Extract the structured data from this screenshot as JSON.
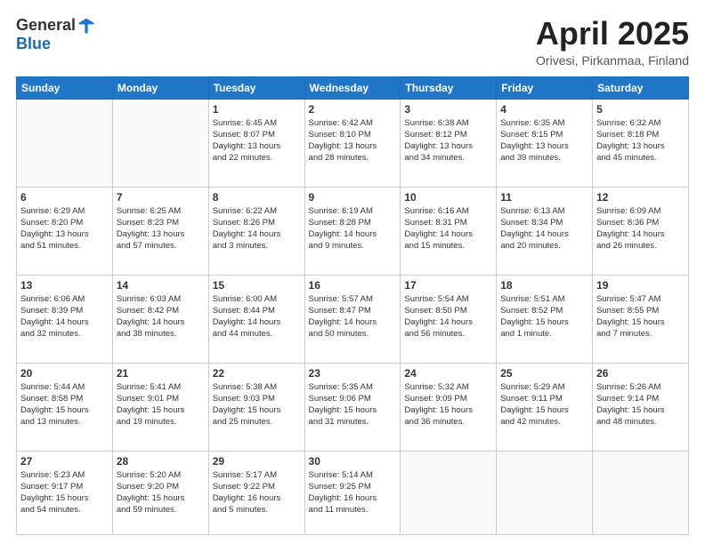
{
  "logo": {
    "general": "General",
    "blue": "Blue"
  },
  "title": "April 2025",
  "subtitle": "Orivesi, Pirkanmaa, Finland",
  "days_header": [
    "Sunday",
    "Monday",
    "Tuesday",
    "Wednesday",
    "Thursday",
    "Friday",
    "Saturday"
  ],
  "weeks": [
    [
      {
        "day": "",
        "info": ""
      },
      {
        "day": "",
        "info": ""
      },
      {
        "day": "1",
        "info": "Sunrise: 6:45 AM\nSunset: 8:07 PM\nDaylight: 13 hours\nand 22 minutes."
      },
      {
        "day": "2",
        "info": "Sunrise: 6:42 AM\nSunset: 8:10 PM\nDaylight: 13 hours\nand 28 minutes."
      },
      {
        "day": "3",
        "info": "Sunrise: 6:38 AM\nSunset: 8:12 PM\nDaylight: 13 hours\nand 34 minutes."
      },
      {
        "day": "4",
        "info": "Sunrise: 6:35 AM\nSunset: 8:15 PM\nDaylight: 13 hours\nand 39 minutes."
      },
      {
        "day": "5",
        "info": "Sunrise: 6:32 AM\nSunset: 8:18 PM\nDaylight: 13 hours\nand 45 minutes."
      }
    ],
    [
      {
        "day": "6",
        "info": "Sunrise: 6:29 AM\nSunset: 8:20 PM\nDaylight: 13 hours\nand 51 minutes."
      },
      {
        "day": "7",
        "info": "Sunrise: 6:25 AM\nSunset: 8:23 PM\nDaylight: 13 hours\nand 57 minutes."
      },
      {
        "day": "8",
        "info": "Sunrise: 6:22 AM\nSunset: 8:26 PM\nDaylight: 14 hours\nand 3 minutes."
      },
      {
        "day": "9",
        "info": "Sunrise: 6:19 AM\nSunset: 8:28 PM\nDaylight: 14 hours\nand 9 minutes."
      },
      {
        "day": "10",
        "info": "Sunrise: 6:16 AM\nSunset: 8:31 PM\nDaylight: 14 hours\nand 15 minutes."
      },
      {
        "day": "11",
        "info": "Sunrise: 6:13 AM\nSunset: 8:34 PM\nDaylight: 14 hours\nand 20 minutes."
      },
      {
        "day": "12",
        "info": "Sunrise: 6:09 AM\nSunset: 8:36 PM\nDaylight: 14 hours\nand 26 minutes."
      }
    ],
    [
      {
        "day": "13",
        "info": "Sunrise: 6:06 AM\nSunset: 8:39 PM\nDaylight: 14 hours\nand 32 minutes."
      },
      {
        "day": "14",
        "info": "Sunrise: 6:03 AM\nSunset: 8:42 PM\nDaylight: 14 hours\nand 38 minutes."
      },
      {
        "day": "15",
        "info": "Sunrise: 6:00 AM\nSunset: 8:44 PM\nDaylight: 14 hours\nand 44 minutes."
      },
      {
        "day": "16",
        "info": "Sunrise: 5:57 AM\nSunset: 8:47 PM\nDaylight: 14 hours\nand 50 minutes."
      },
      {
        "day": "17",
        "info": "Sunrise: 5:54 AM\nSunset: 8:50 PM\nDaylight: 14 hours\nand 56 minutes."
      },
      {
        "day": "18",
        "info": "Sunrise: 5:51 AM\nSunset: 8:52 PM\nDaylight: 15 hours\nand 1 minute."
      },
      {
        "day": "19",
        "info": "Sunrise: 5:47 AM\nSunset: 8:55 PM\nDaylight: 15 hours\nand 7 minutes."
      }
    ],
    [
      {
        "day": "20",
        "info": "Sunrise: 5:44 AM\nSunset: 8:58 PM\nDaylight: 15 hours\nand 13 minutes."
      },
      {
        "day": "21",
        "info": "Sunrise: 5:41 AM\nSunset: 9:01 PM\nDaylight: 15 hours\nand 19 minutes."
      },
      {
        "day": "22",
        "info": "Sunrise: 5:38 AM\nSunset: 9:03 PM\nDaylight: 15 hours\nand 25 minutes."
      },
      {
        "day": "23",
        "info": "Sunrise: 5:35 AM\nSunset: 9:06 PM\nDaylight: 15 hours\nand 31 minutes."
      },
      {
        "day": "24",
        "info": "Sunrise: 5:32 AM\nSunset: 9:09 PM\nDaylight: 15 hours\nand 36 minutes."
      },
      {
        "day": "25",
        "info": "Sunrise: 5:29 AM\nSunset: 9:11 PM\nDaylight: 15 hours\nand 42 minutes."
      },
      {
        "day": "26",
        "info": "Sunrise: 5:26 AM\nSunset: 9:14 PM\nDaylight: 15 hours\nand 48 minutes."
      }
    ],
    [
      {
        "day": "27",
        "info": "Sunrise: 5:23 AM\nSunset: 9:17 PM\nDaylight: 15 hours\nand 54 minutes."
      },
      {
        "day": "28",
        "info": "Sunrise: 5:20 AM\nSunset: 9:20 PM\nDaylight: 15 hours\nand 59 minutes."
      },
      {
        "day": "29",
        "info": "Sunrise: 5:17 AM\nSunset: 9:22 PM\nDaylight: 16 hours\nand 5 minutes."
      },
      {
        "day": "30",
        "info": "Sunrise: 5:14 AM\nSunset: 9:25 PM\nDaylight: 16 hours\nand 11 minutes."
      },
      {
        "day": "",
        "info": ""
      },
      {
        "day": "",
        "info": ""
      },
      {
        "day": "",
        "info": ""
      }
    ]
  ]
}
